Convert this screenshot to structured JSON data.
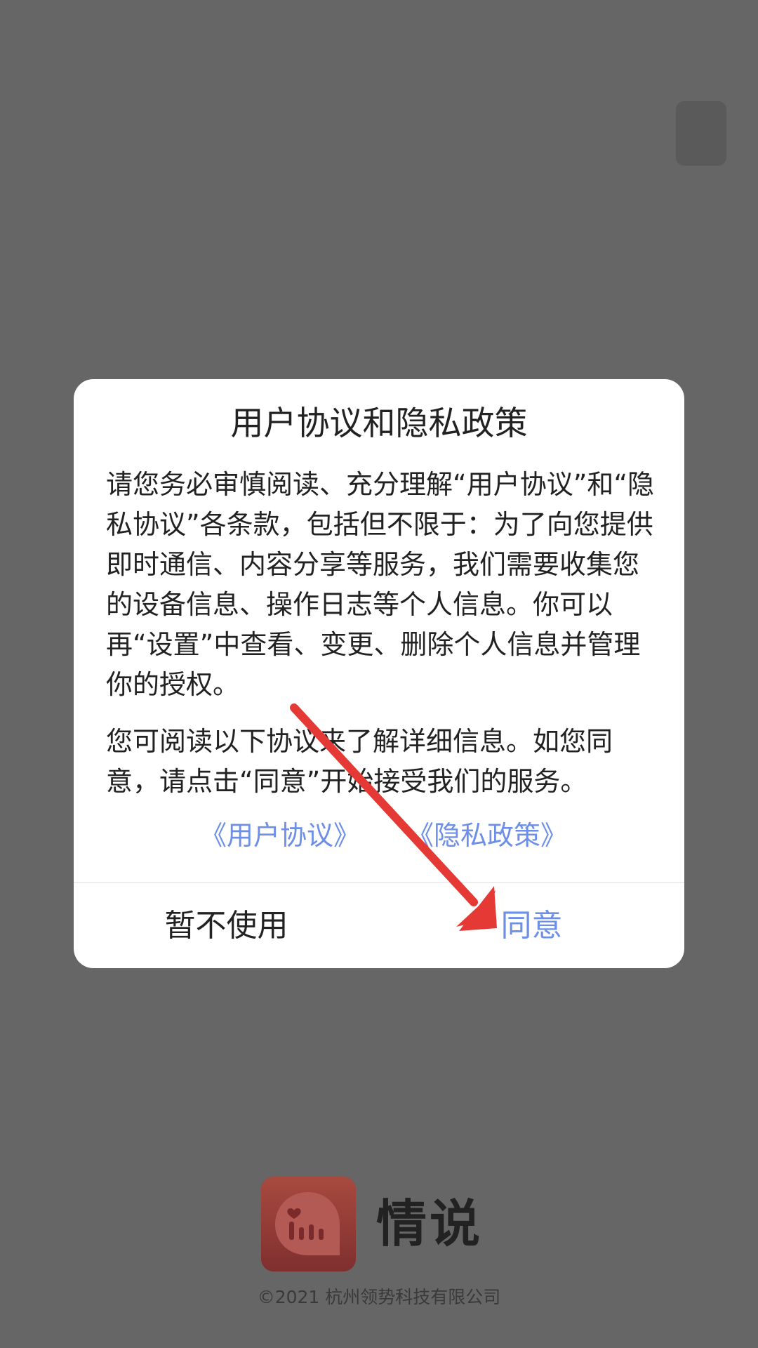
{
  "dialog": {
    "title": "用户协议和隐私政策",
    "paragraph1": "请您务必审慎阅读、充分理解“用户协议”和“隐私协议”各条款，包括但不限于：为了向您提供即时通信、内容分享等服务，我们需要收集您的设备信息、操作日志等个人信息。你可以再“设置”中查看、变更、删除个人信息并管理你的授权。",
    "paragraph2": "您可阅读以下协议来了解详细信息。如您同意，请点击“同意”开始接受我们的服务。",
    "user_agreement_link": "《用户协议》",
    "privacy_policy_link": "《隐私政策》",
    "decline_button": "暂不使用",
    "agree_button": "同意"
  },
  "brand": {
    "app_name": "情说",
    "copyright": "©2021 杭州领势科技有限公司"
  },
  "colors": {
    "overlay": "#666666",
    "link": "#6e8fe8",
    "annotation_arrow": "#e53935",
    "logo_gradient_top": "#e8504a",
    "logo_gradient_bottom": "#c0392b"
  },
  "icons": {
    "logo": "chat-bubble-heart-bars-icon",
    "annotation": "red-arrow-annotation"
  }
}
